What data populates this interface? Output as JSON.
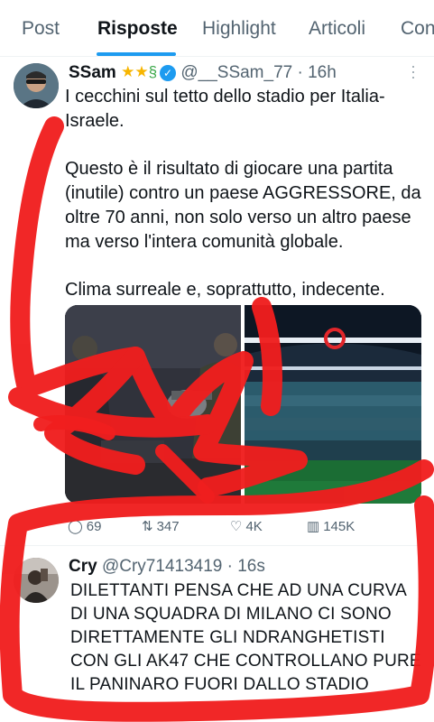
{
  "tabs": [
    {
      "label": "Post",
      "active": false
    },
    {
      "label": "Risposte",
      "active": true
    },
    {
      "label": "Highlight",
      "active": false
    },
    {
      "label": "Articoli",
      "active": false
    },
    {
      "label": "Con",
      "active": false
    }
  ],
  "tweet1": {
    "display_name": "SSam",
    "badges": [
      "star",
      "star",
      "snake",
      "verified-badge"
    ],
    "handle": "@__SSam_77",
    "separator": "·",
    "time": "16h",
    "paragraphs": [
      "I cecchini sul tetto dello stadio per Italia-Israele.",
      "Questo è il risultato di giocare una partita (inutile) contro un paese AGGRESSORE, da oltre 70 anni, non solo verso un altro paese ma verso l'intera comunità globale.",
      "Clima surreale e, soprattutto, indecente."
    ],
    "actions": {
      "replies": "69",
      "reposts": "347",
      "likes": "4K",
      "views": "145K"
    }
  },
  "tweet2": {
    "display_name": "Cry",
    "handle": "@Cry71413419",
    "separator": "·",
    "time": "16s",
    "text": "DILETTANTI PENSA CHE AD UNA CURVA DI UNA SQUADRA DI MILANO CI SONO DIRETTAMENTE GLI NDRANGHETISTI CON GLI AK47 CHE CONTROLLANO PURE IL PANINARO FUORI DALLO STADIO"
  },
  "colors": {
    "accent": "#1d9bf0",
    "annotation": "#f01e1e",
    "muted": "#536471"
  }
}
